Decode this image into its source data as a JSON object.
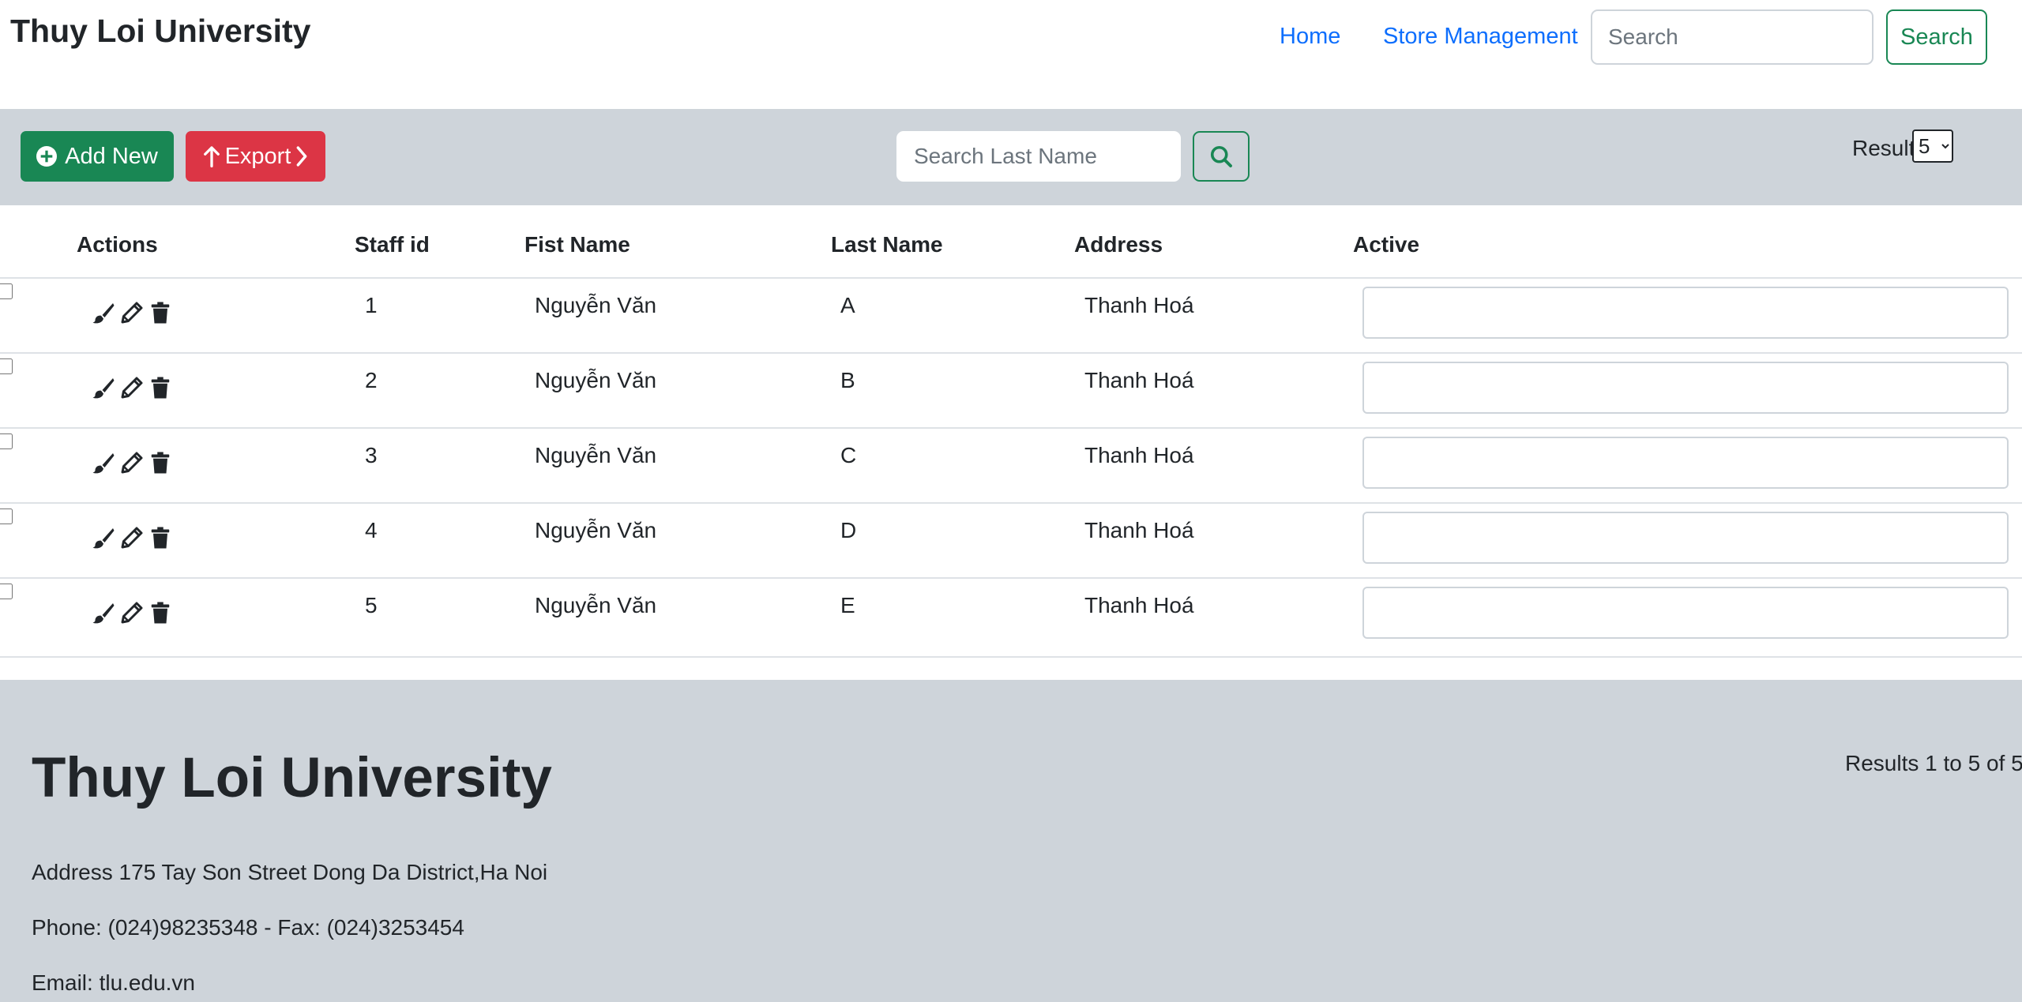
{
  "navbar": {
    "brand": "Thuy Loi University",
    "links": [
      "Home",
      "Store Management"
    ],
    "search_placeholder": "Search",
    "search_button": "Search"
  },
  "toolbar": {
    "add_label": "Add New",
    "export_label": "Export",
    "lastname_placeholder": "Search Last Name",
    "result_label": "Result",
    "result_value": "5",
    "result_options": [
      "5"
    ]
  },
  "table": {
    "headers": [
      "Actions",
      "Staff id",
      "Fist Name",
      "Last Name",
      "Address",
      "Active"
    ],
    "rows": [
      {
        "id": "1",
        "first": "Nguyễn Văn",
        "last": "A",
        "address": "Thanh Hoá",
        "active": ""
      },
      {
        "id": "2",
        "first": "Nguyễn Văn",
        "last": "B",
        "address": "Thanh Hoá",
        "active": ""
      },
      {
        "id": "3",
        "first": "Nguyễn Văn",
        "last": "C",
        "address": "Thanh Hoá",
        "active": ""
      },
      {
        "id": "4",
        "first": "Nguyễn Văn",
        "last": "D",
        "address": "Thanh Hoá",
        "active": ""
      },
      {
        "id": "5",
        "first": "Nguyễn Văn",
        "last": "E",
        "address": "Thanh Hoá",
        "active": ""
      }
    ],
    "row_icons": [
      "brush-icon",
      "pencil-icon",
      "trash-icon"
    ]
  },
  "footer": {
    "title": "Thuy Loi University",
    "results": "Results 1 to 5 of 5",
    "address": "Address 175 Tay Son Street Dong Da District,Ha Noi",
    "phone": "Phone: (024)98235348 - Fax: (024)3253454",
    "email": "Email: tlu.edu.vn"
  },
  "colors": {
    "primary_link": "#0d6efd",
    "success": "#198754",
    "danger": "#dc3545",
    "band_gray": "#ced4da",
    "text_dark": "#212529"
  }
}
